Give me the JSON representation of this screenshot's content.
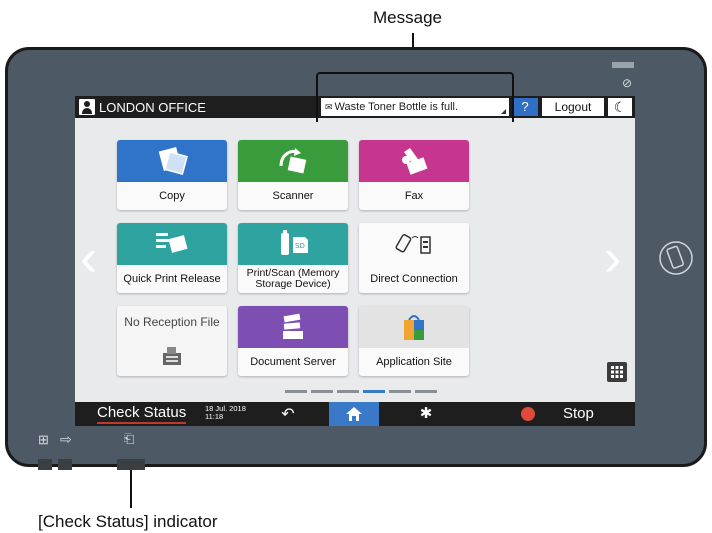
{
  "callouts": {
    "message_label": "Message",
    "check_status_indicator_label": "[Check Status] indicator"
  },
  "topbar": {
    "office_name": "LONDON OFFICE",
    "message_text": "Waste Toner Bottle is full.",
    "help_label": "?",
    "logout_label": "Logout"
  },
  "apps": [
    {
      "label": "Copy",
      "color": "#2f74c8",
      "icon": "copy-icon"
    },
    {
      "label": "Scanner",
      "color": "#3a9b3c",
      "icon": "scanner-icon"
    },
    {
      "label": "Fax",
      "color": "#c6358e",
      "icon": "fax-icon"
    },
    {
      "label": "Quick Print Release",
      "color": "#2fa3a0",
      "icon": "quick-print-icon"
    },
    {
      "label": "Print/Scan (Memory Storage Device)",
      "color": "#2fa3a0",
      "icon": "usb-sd-icon"
    },
    {
      "label": "Direct Connection",
      "color": "#f5f5f5",
      "icon": "direct-connection-icon"
    },
    {
      "label": "No Reception File",
      "color": "#f5f5f5",
      "icon": "fax-machine-icon"
    },
    {
      "label": "Document Server",
      "color": "#7e4fb3",
      "icon": "document-server-icon"
    },
    {
      "label": "Application Site",
      "color": "#e3e3e3",
      "icon": "shopping-bag-icon"
    }
  ],
  "bottombar": {
    "check_status_label": "Check Status",
    "date": "18 Jul. 2018",
    "time": "11:18",
    "stop_label": "Stop"
  },
  "colors": {
    "device_frame": "#4d5a66",
    "screen_bg": "#e9eaec",
    "bar_bg": "#1e1e1e",
    "accent_blue": "#3a78c8",
    "stop_red": "#e04a3a"
  }
}
